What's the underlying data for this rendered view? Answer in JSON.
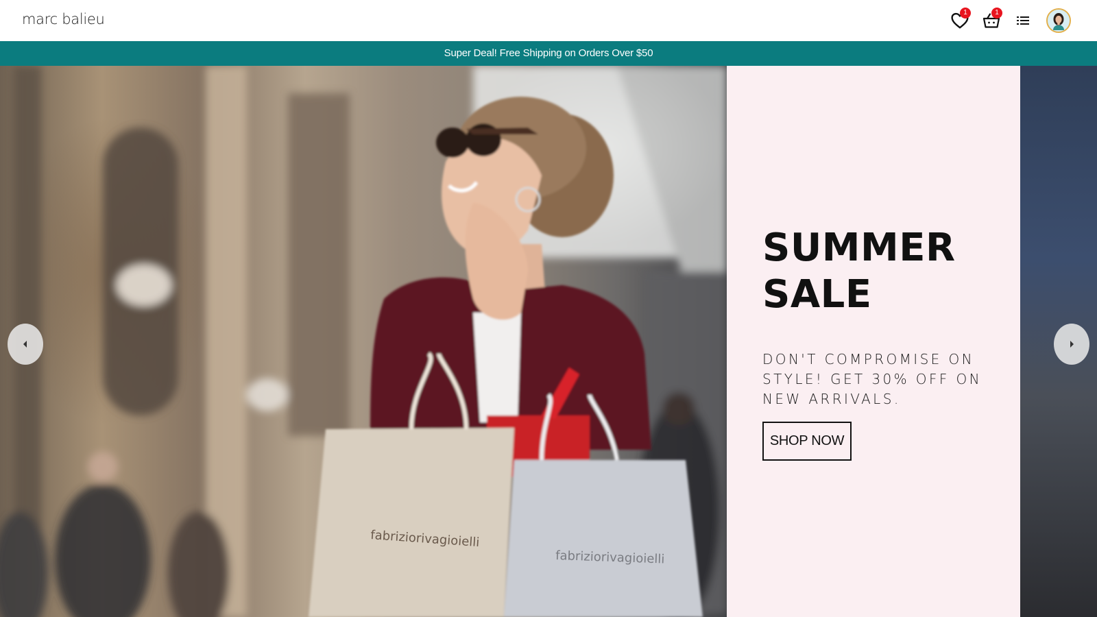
{
  "header": {
    "logo": "marc balieu",
    "icons": [
      {
        "name": "heart-icon",
        "badge": "1"
      },
      {
        "name": "basket-icon",
        "badge": "1"
      },
      {
        "name": "list-icon"
      },
      {
        "name": "avatar"
      }
    ]
  },
  "promo": {
    "text": "Super Deal! Free Shipping on Orders Over $50",
    "color": "#0b7c7f"
  },
  "hero": {
    "title_line1": "SUMMER",
    "title_line2": "SALE",
    "subtitle": "DON'T COMPROMISE ON STYLE! GET 30% OFF ON NEW ARRIVALS.",
    "cta": "SHOP NOW",
    "panel_color": "#fbeff2",
    "bag_brand": "fabriziorivagioielli"
  }
}
